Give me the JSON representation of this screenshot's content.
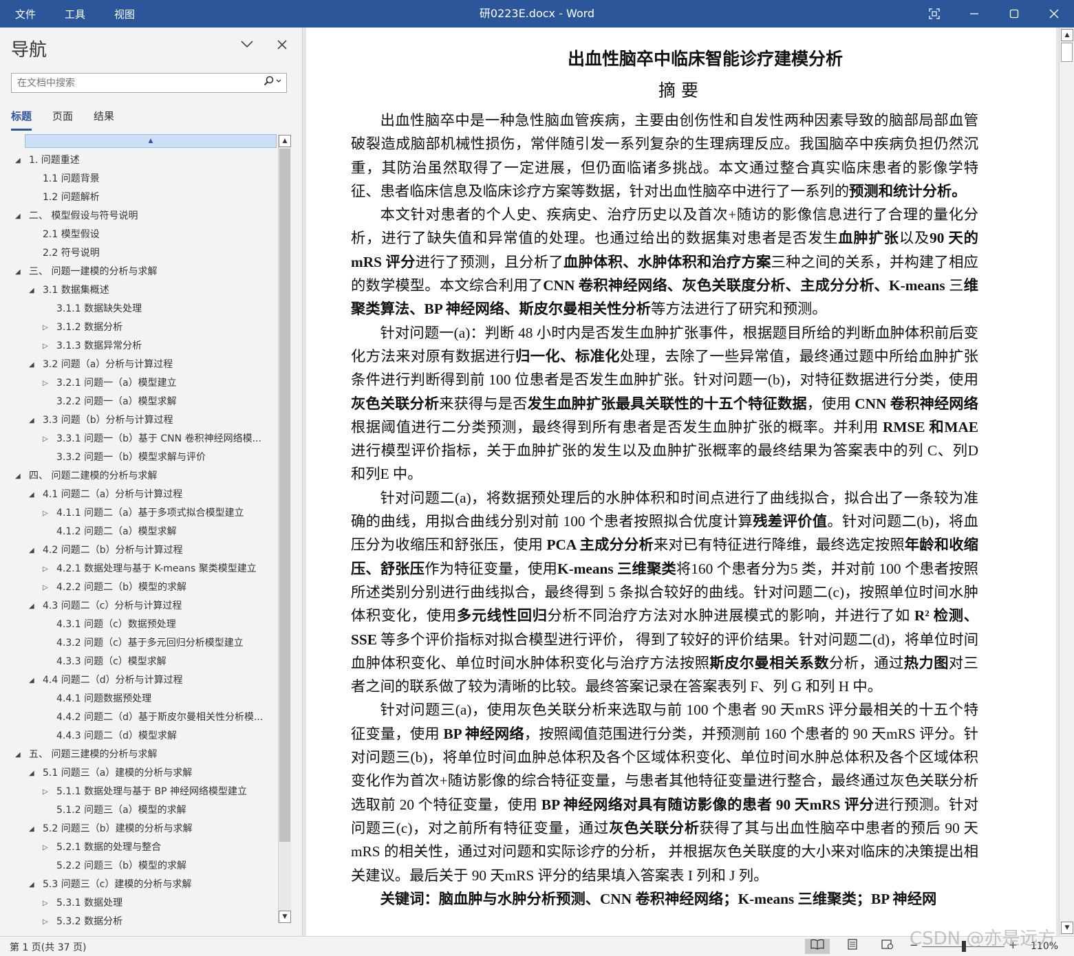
{
  "titlebar": {
    "menu": [
      "文件",
      "工具",
      "视图"
    ],
    "title": "研0223E.docx  -  Word"
  },
  "nav": {
    "title": "导航",
    "search_placeholder": "在文档中搜索",
    "tabs": [
      "标题",
      "页面",
      "结果"
    ],
    "active_tab": "标题",
    "items": [
      {
        "text": "1. 问题重述",
        "level": 1,
        "toggle": "expanded"
      },
      {
        "text": "1.1 问题背景",
        "level": 2,
        "toggle": "none"
      },
      {
        "text": "1.2 问题解析",
        "level": 2,
        "toggle": "none"
      },
      {
        "text": "二、 模型假设与符号说明",
        "level": 1,
        "toggle": "expanded"
      },
      {
        "text": "2.1 模型假设",
        "level": 2,
        "toggle": "none"
      },
      {
        "text": "2.2 符号说明",
        "level": 2,
        "toggle": "none"
      },
      {
        "text": "三、 问题一建模的分析与求解",
        "level": 1,
        "toggle": "expanded"
      },
      {
        "text": "3.1 数据集概述",
        "level": 2,
        "toggle": "expanded"
      },
      {
        "text": "3.1.1 数据缺失处理",
        "level": 3,
        "toggle": "none"
      },
      {
        "text": "3.1.2 数据分析",
        "level": 3,
        "toggle": "collapsed"
      },
      {
        "text": "3.1.3 数据异常分析",
        "level": 3,
        "toggle": "collapsed"
      },
      {
        "text": "3.2 问题（a）分析与计算过程",
        "level": 2,
        "toggle": "expanded"
      },
      {
        "text": "3.2.1 问题一（a）模型建立",
        "level": 3,
        "toggle": "collapsed"
      },
      {
        "text": "3.2.2 问题一（a）模型求解",
        "level": 3,
        "toggle": "none"
      },
      {
        "text": "3.3 问题（b）分析与计算过程",
        "level": 2,
        "toggle": "expanded"
      },
      {
        "text": "3.3.1 问题一（b）基于 CNN 卷积神经网络模...",
        "level": 3,
        "toggle": "collapsed"
      },
      {
        "text": "3.3.2 问题一（b）模型求解与评价",
        "level": 3,
        "toggle": "none"
      },
      {
        "text": "四、 问题二建模的分析与求解",
        "level": 1,
        "toggle": "expanded"
      },
      {
        "text": "4.1 问题二（a）分析与计算过程",
        "level": 2,
        "toggle": "expanded"
      },
      {
        "text": "4.1.1 问题二（a）基于多项式拟合模型建立",
        "level": 3,
        "toggle": "collapsed"
      },
      {
        "text": "4.1.2 问题二（a）模型求解",
        "level": 3,
        "toggle": "none"
      },
      {
        "text": "4.2 问题二（b）分析与计算过程",
        "level": 2,
        "toggle": "expanded"
      },
      {
        "text": "4.2.1 数据处理与基于 K-means 聚类模型建立",
        "level": 3,
        "toggle": "collapsed"
      },
      {
        "text": "4.2.2 问题二（b）模型的求解",
        "level": 3,
        "toggle": "collapsed"
      },
      {
        "text": "4.3 问题二（c）分析与计算过程",
        "level": 2,
        "toggle": "expanded"
      },
      {
        "text": "4.3.1 问题（c）数据预处理",
        "level": 3,
        "toggle": "none"
      },
      {
        "text": "4.3.2 问题（c）基于多元回归分析模型建立",
        "level": 3,
        "toggle": "none"
      },
      {
        "text": "4.3.3 问题（c）模型求解",
        "level": 3,
        "toggle": "none"
      },
      {
        "text": "4.4 问题二（d）分析与计算过程",
        "level": 2,
        "toggle": "expanded"
      },
      {
        "text": "4.4.1 问题数据预处理",
        "level": 3,
        "toggle": "none"
      },
      {
        "text": "4.4.2 问题二（d）基于斯皮尔曼相关性分析模...",
        "level": 3,
        "toggle": "none"
      },
      {
        "text": "4.4.3 问题二（d）模型求解",
        "level": 3,
        "toggle": "none"
      },
      {
        "text": "五、 问题三建模的分析与求解",
        "level": 1,
        "toggle": "expanded"
      },
      {
        "text": "5.1 问题三（a）建模的分析与求解",
        "level": 2,
        "toggle": "expanded"
      },
      {
        "text": "5.1.1 数据处理与基于 BP 神经网络模型建立",
        "level": 3,
        "toggle": "collapsed"
      },
      {
        "text": "5.1.2 问题三（a）模型的求解",
        "level": 3,
        "toggle": "none"
      },
      {
        "text": "5.2 问题三（b）建模的分析与求解",
        "level": 2,
        "toggle": "expanded"
      },
      {
        "text": "5.2.1 数据的处理与整合",
        "level": 3,
        "toggle": "collapsed"
      },
      {
        "text": "5.2.2 问题三（b）模型的求解",
        "level": 3,
        "toggle": "none"
      },
      {
        "text": "5.3 问题三（c）建模的分析与求解",
        "level": 2,
        "toggle": "expanded"
      },
      {
        "text": "5.3.1 数据处理",
        "level": 3,
        "toggle": "collapsed"
      },
      {
        "text": "5.3.2 数据分析",
        "level": 3,
        "toggle": "collapsed"
      }
    ]
  },
  "document": {
    "title": "出血性脑卒中临床智能诊疗建模分析",
    "abstract_heading": "摘要",
    "paragraphs": [
      [
        {
          "t": "出血性脑卒中是一种急性脑血管疾病，主要由创伤性和自发性两种因素导致的脑部局部血管破裂造成脑部机械性损伤，常伴随引发一系列复杂的生理病理反应。我国脑卒中疾病负担仍然沉重，其防治虽然取得了一定进展，但仍面临诸多挑战。本文通过整合真实临床患者的影像学特征、患者临床信息及临床诊疗方案等数据，针对出血性脑卒中进行了一系列的"
        },
        {
          "t": "预测和统计分析。",
          "b": true
        }
      ],
      [
        {
          "t": "本文针对患者的个人史、疾病史、治疗历史以及首次+随访的影像信息进行了合理的量化分析，进行了缺失值和异常值的处理。也通过给出的数据集对患者是否发生"
        },
        {
          "t": "血肿扩张",
          "b": true
        },
        {
          "t": "以及"
        },
        {
          "t": "90 天的 mRS 评分",
          "b": true
        },
        {
          "t": "进行了预测，且分析了"
        },
        {
          "t": "血肿体积、水肿体积和治疗方案",
          "b": true
        },
        {
          "t": "三种之间的关系，并构建了相应的数学模型。本文综合利用了"
        },
        {
          "t": "CNN 卷积神经网络、灰色关联度分析、主成分分析、K-means",
          "b": true
        },
        {
          "t": " 三"
        },
        {
          "t": "维聚类算法、BP 神经网络、斯皮尔曼相关性分析",
          "b": true
        },
        {
          "t": "等方法进行了研究和预测。"
        }
      ],
      [
        {
          "t": "针对问题一(a)：判断 48 小时内是否发生血肿扩张事件，根据题目所给的判断血肿体积前后变化方法来对原有数据进行"
        },
        {
          "t": "归一化、标准化",
          "b": true
        },
        {
          "t": "处理，去除了一些异常值，最终通过题中所给血肿扩张条件进行判断得到前 100 位患者是否发生血肿扩张。针对问题一(b)，对特征数据进行分类，使用"
        },
        {
          "t": "灰色关联分析",
          "b": true
        },
        {
          "t": "来获得与是否"
        },
        {
          "t": "发生血肿扩张最具关联性的十五个特征数据",
          "b": true
        },
        {
          "t": "，使用 "
        },
        {
          "t": "CNN 卷积神经网络",
          "b": true
        },
        {
          "t": "根据阈值进行二分类预测，最终得到所有患者是否发生血肿扩张的概率。并利用 "
        },
        {
          "t": "RMSE 和MAE",
          "b": true
        },
        {
          "t": " 进行模型评价指标，关于血肿扩张的发生以及血肿扩张概率的最终结果为答案表中的列 C、列D 和列E 中。"
        }
      ],
      [
        {
          "t": "针对问题二(a)，将数据预处理后的水肿体积和时间点进行了曲线拟合，拟合出了一条较为准确的曲线，用拟合曲线分别对前 100 个患者按照拟合优度计算"
        },
        {
          "t": "残差评价值",
          "b": true
        },
        {
          "t": "。针对问题二(b)，将血压分为收缩压和舒张压，使用 "
        },
        {
          "t": "PCA 主成分分析",
          "b": true
        },
        {
          "t": "来对已有特征进行降维，最终选定按照"
        },
        {
          "t": "年龄和收缩压、舒张压",
          "b": true
        },
        {
          "t": "作为特征变量，使用"
        },
        {
          "t": "K-means 三维聚类",
          "b": true
        },
        {
          "t": "将160 个患者分为5 类，并对前 100 个患者按照所述类别分别进行曲线拟合，最终得到 5 条拟合较好的曲线。针对问题二(c)，按照单位时间水肿体积变化，使用"
        },
        {
          "t": "多元线性回归",
          "b": true
        },
        {
          "t": "分析不同治疗方法对水肿进展模式的影响，并进行了如 "
        },
        {
          "t": "R² 检测、SSE",
          "b": true
        },
        {
          "t": " 等多个评价指标对拟合模型进行评价，  得到了较好的评价结果。针对问题二(d)，将单位时间血肿体积变化、单位时间水肿体积变化与治疗方法按照"
        },
        {
          "t": "斯皮尔曼相关系数",
          "b": true
        },
        {
          "t": "分析，通过"
        },
        {
          "t": "热力图",
          "b": true
        },
        {
          "t": "对三者之间的联系做了较为清晰的比较。最终答案记录在答案表列 F、列 G 和列 H 中。"
        }
      ],
      [
        {
          "t": "针对问题三(a)，使用灰色关联分析来选取与前 100 个患者 90 天mRS 评分最相关的十五个特征变量，使用 "
        },
        {
          "t": "BP 神经网络",
          "b": true
        },
        {
          "t": "，按照阈值范围进行分类，并预测前 160 个患者的 90 天mRS 评分。针对问题三(b)，将单位时间血肿总体积及各个区域体积变化、单位时间水肿总体积及各个区域体积变化作为首次+随访影像的综合特征变量，与患者其他特征变量进行整合，最终通过灰色关联分析选取前 20 个特征变量，使用 "
        },
        {
          "t": "BP 神经网络对具有随访影像的患者 90 天mRS 评分",
          "b": true
        },
        {
          "t": "进行预测。针对问题三(c)，对之前所有特征变量，通过"
        },
        {
          "t": "灰色关联分析",
          "b": true
        },
        {
          "t": "获得了其与出血性脑卒中患者的预后 90 天 mRS 的相关性，通过对问题和实际诊疗的分析，  并根据灰色关联度的大小来对临床的决策提出相关建议。最后关于 90 天mRS 评分的结果填入答案表 I 列和 J 列。"
        }
      ],
      [
        {
          "t": "关键词：脑血肿与水肿分析预测、CNN 卷积神经网络；K-means 三维聚类；BP 神经网",
          "b": true
        }
      ]
    ]
  },
  "statusbar": {
    "page_info": "第 1 页(共 37 页)",
    "zoom_minus": "−",
    "zoom_plus": "+",
    "zoom_pct": "110%"
  },
  "watermark": "CSDN @亦是远方",
  "colors": {
    "accent": "#2b579a",
    "nav_bg": "#f3f3f3",
    "highlight": "#cde0f7"
  }
}
